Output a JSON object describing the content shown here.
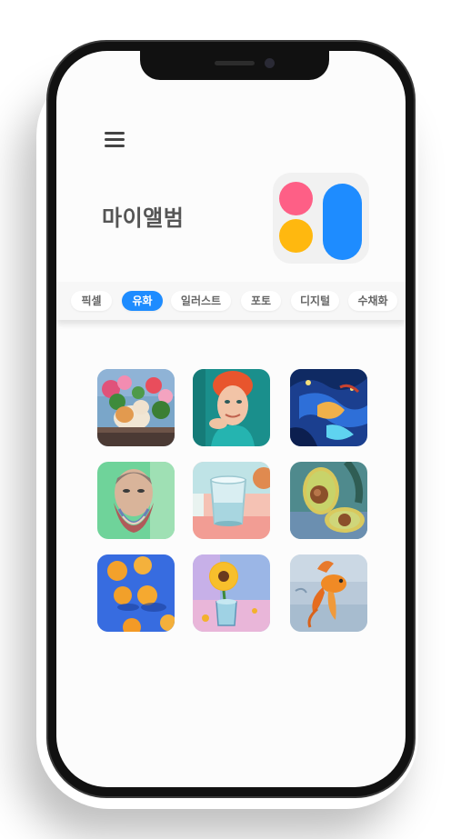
{
  "app": {
    "title": "마이앨범"
  },
  "logo": {
    "colors": {
      "dot_top": "#fe5f86",
      "dot_bottom": "#ffb80f",
      "pill": "#1e8cff"
    }
  },
  "menu": {
    "icon": "hamburger-menu-icon"
  },
  "categories": [
    {
      "label": "픽셀",
      "active": false
    },
    {
      "label": "유화",
      "active": true
    },
    {
      "label": "일러스트",
      "active": false
    },
    {
      "label": "포토",
      "active": false
    },
    {
      "label": "디지털",
      "active": false
    },
    {
      "label": "수채화",
      "active": false
    }
  ],
  "theme": {
    "accent": "#1e8cff",
    "background": "#fcfcfc",
    "text": "#555555"
  },
  "gallery": {
    "artworks": [
      {
        "subject": "flowers-and-cat-painting"
      },
      {
        "subject": "teal-portrait-painting"
      },
      {
        "subject": "abstract-blue-portrait-painting"
      },
      {
        "subject": "bearded-man-portrait-painting"
      },
      {
        "subject": "glass-of-water-painting"
      },
      {
        "subject": "avocado-painting"
      },
      {
        "subject": "oranges-on-blue-painting"
      },
      {
        "subject": "sunflower-vase-painting"
      },
      {
        "subject": "goldfish-painting"
      }
    ]
  }
}
